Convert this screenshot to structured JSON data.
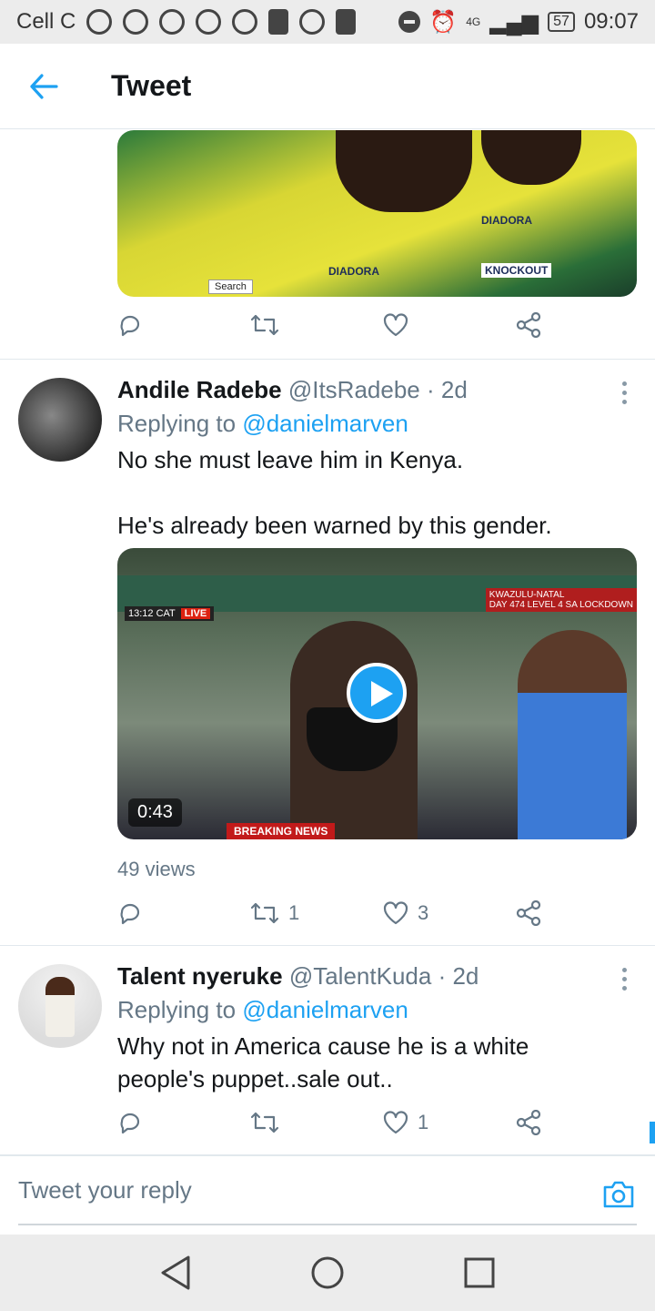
{
  "status_bar": {
    "carrier": "Cell C",
    "network": "4G",
    "battery": "57",
    "time": "09:07"
  },
  "header": {
    "title": "Tweet"
  },
  "top_media": {
    "search_badge": "Search",
    "brand_left": "DIADORA",
    "brand_right": "DIADORA",
    "sponsor": "KNOCKOUT"
  },
  "top_actions": {
    "reply_count": "",
    "retweet_count": "",
    "like_count": ""
  },
  "tweets": [
    {
      "name": "Andile Radebe",
      "handle": "@ItsRadebe",
      "sep": "·",
      "time": "2d",
      "replying_prefix": "Replying to",
      "replying_handle": "@danielmarven",
      "text": "No she must leave him in Kenya.\n\nHe's already been warned by this gender.",
      "video": {
        "duration": "0:43",
        "timestamp": "13:12 CAT",
        "live": "LIVE",
        "region": "KWAZULU-NATAL",
        "subtitle": "DAY 474 LEVEL 4 SA LOCKDOWN",
        "ticker": "BREAKING NEWS"
      },
      "views": "49 views",
      "retweets": "1",
      "likes": "3"
    },
    {
      "name": "Talent nyeruke",
      "handle": "@TalentKuda",
      "sep": "·",
      "time": "2d",
      "replying_prefix": "Replying to",
      "replying_handle": "@danielmarven",
      "text": "Why not in America cause he is a white people's puppet..sale out..",
      "retweets": "",
      "likes": "1"
    }
  ],
  "reply_box": {
    "placeholder": "Tweet your reply"
  },
  "colors": {
    "accent": "#1da1f2",
    "muted": "#657786"
  }
}
